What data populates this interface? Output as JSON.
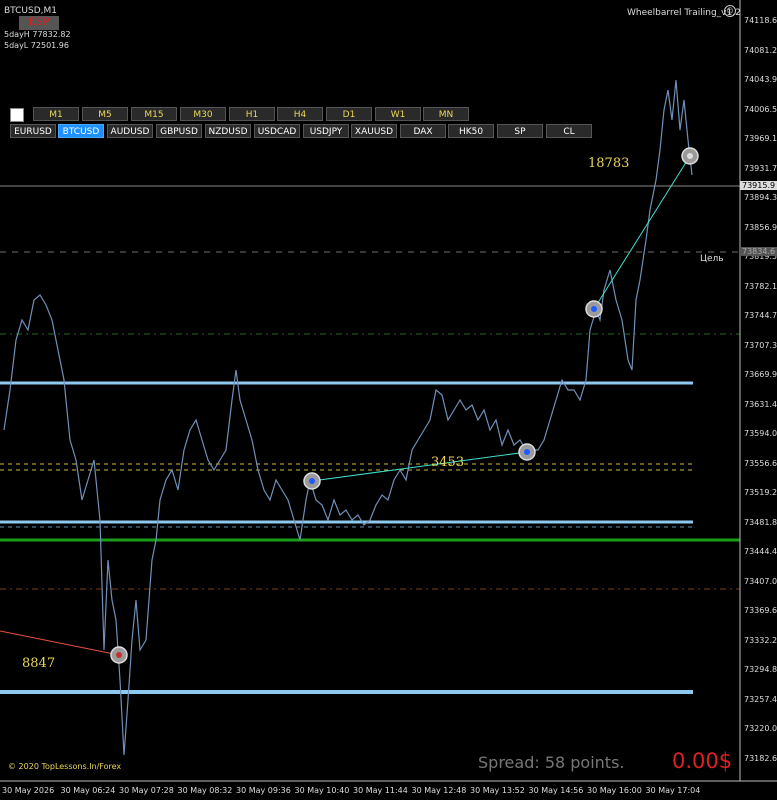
{
  "window": {
    "symbol_title": "BTCUSD,M1",
    "indicator_title": "Wheelbarrel Trailing_v1.2",
    "esp_label": "ESP",
    "day_high": "5dayH 77832.82",
    "day_low": "5dayL 72501.96"
  },
  "timeframes": [
    "M1",
    "M5",
    "M15",
    "M30",
    "H1",
    "H4",
    "D1",
    "W1",
    "MN"
  ],
  "symbols": [
    "EURUSD",
    "BTCUSD",
    "AUDUSD",
    "GBPUSD",
    "NZDUSD",
    "USDCAD",
    "USDJPY",
    "XAUUSD",
    "DAX",
    "HK50",
    "SP",
    "CL"
  ],
  "active_symbol": "BTCUSD",
  "price_axis": [
    "74118.60",
    "74081.20",
    "74043.90",
    "74006.50",
    "73969.10",
    "73931.70",
    "73894.30",
    "73856.90",
    "73819.50",
    "73782.10",
    "73744.70",
    "73707.30",
    "73669.90",
    "73631.40",
    "73594.00",
    "73556.60",
    "73519.20",
    "73481.80",
    "73444.40",
    "73407.00",
    "73369.60",
    "73332.20",
    "73294.80",
    "73257.40",
    "73220.00",
    "73182.60"
  ],
  "price_axis_display": [
    "74118.6",
    "74081.2",
    "74043.9",
    "74006.5",
    "73969.1",
    "73931.7",
    "73894.3",
    "73856.9",
    "73819.5",
    "73782.1",
    "73744.7",
    "73707.3",
    "73669.9",
    "73631.4",
    "73594.0",
    "73556.6",
    "73519.2",
    "73481.8",
    "73444.4",
    "73407.0",
    "73369.6",
    "73332.2",
    "73294.8",
    "73257.4",
    "73220.0",
    "73182.6"
  ],
  "current_price": "73915.9",
  "target_price": "73834.6",
  "target_label": "Цель",
  "time_axis": [
    "30 May 2026",
    "30 May 06:24",
    "30 May 07:28",
    "30 May 08:32",
    "30 May 09:36",
    "30 May 10:40",
    "30 May 11:44",
    "30 May 12:48",
    "30 May 13:52",
    "30 May 14:56",
    "30 May 16:00",
    "30 May 17:04"
  ],
  "trade_labels": [
    "8847",
    "3453",
    "18783"
  ],
  "copyright": "© 2020 TopLessons.In/Forex",
  "spread": "Spread: 58 points.",
  "profit": "0.00$",
  "colors": {
    "background": "#000000",
    "price_line": "#6f8fb0",
    "cyan_line": "#40e0d0",
    "green": "#1a9e1a",
    "light_blue": "#87c8f0",
    "label_yellow": "#e8d75a",
    "profit_red": "#e02020"
  }
}
